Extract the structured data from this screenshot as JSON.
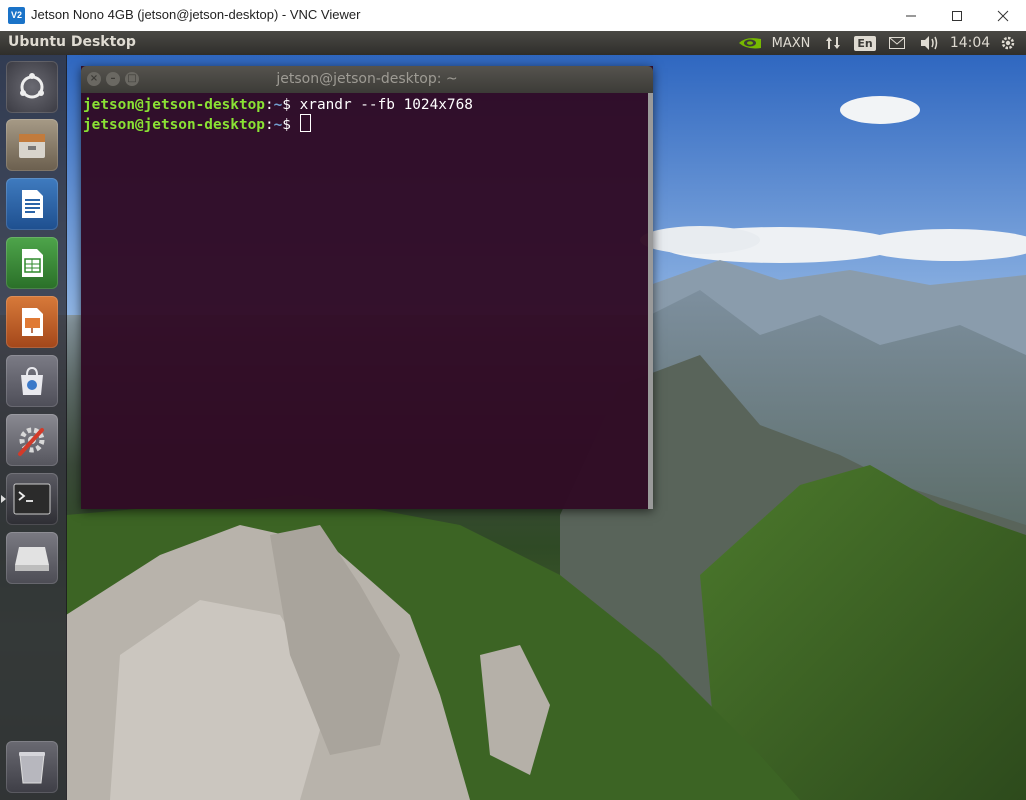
{
  "vnc": {
    "logo": "V2",
    "title": "Jetson Nono 4GB (jetson@jetson-desktop) - VNC Viewer",
    "controls": {
      "minimize": "minimize-icon",
      "maximize": "maximize-icon",
      "close": "close-icon"
    }
  },
  "panel": {
    "title": "Ubuntu Desktop",
    "indicators": {
      "nvidia_text": "MAXN",
      "keyboard": "En",
      "clock": "14:04"
    }
  },
  "launcher": {
    "items": [
      {
        "name": "ubuntu-dash-icon"
      },
      {
        "name": "files-icon"
      },
      {
        "name": "libreoffice-writer-icon"
      },
      {
        "name": "libreoffice-calc-icon"
      },
      {
        "name": "libreoffice-impress-icon"
      },
      {
        "name": "ubuntu-software-icon"
      },
      {
        "name": "system-settings-icon"
      },
      {
        "name": "terminal-icon"
      },
      {
        "name": "drive-icon"
      },
      {
        "name": "trash-icon"
      }
    ]
  },
  "terminal": {
    "title": "jetson@jetson-desktop: ~",
    "lines": [
      {
        "user": "jetson@jetson-desktop",
        "sep": ":",
        "path": "~",
        "prompt": "$ ",
        "command": "xrandr --fb 1024x768"
      },
      {
        "user": "jetson@jetson-desktop",
        "sep": ":",
        "path": "~",
        "prompt": "$ ",
        "command": ""
      }
    ]
  },
  "colors": {
    "prompt_user": "#8ae234",
    "prompt_path": "#729fcf",
    "terminal_bg": "#300a24",
    "panel_bg": "#3c3b37"
  }
}
